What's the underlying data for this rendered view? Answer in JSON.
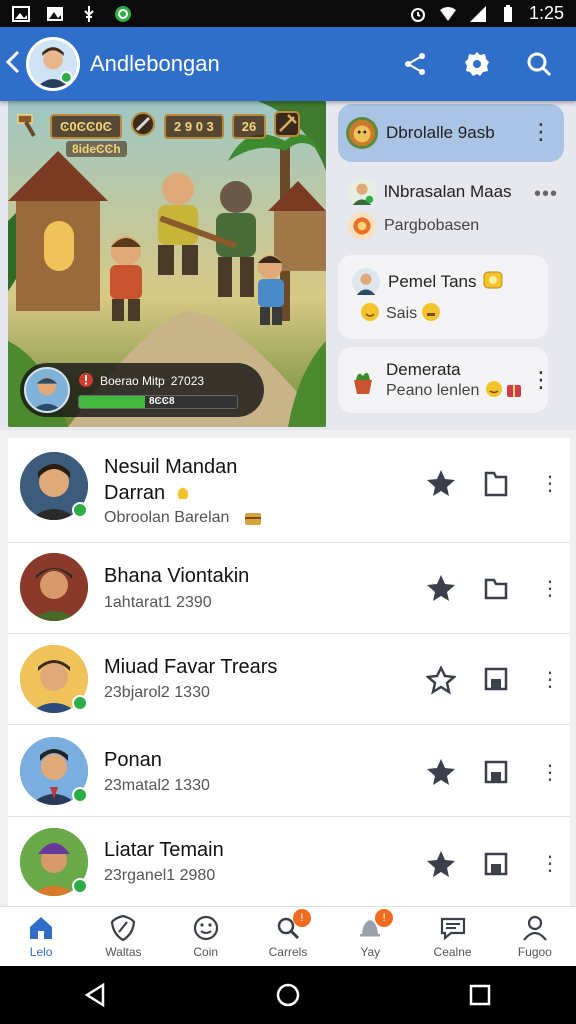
{
  "status_bar": {
    "time": "1:25"
  },
  "header": {
    "title": "Andlebongan"
  },
  "game": {
    "hud_coins": "Ͼ0ϾϾ0Ͼ",
    "hud_sub": "8ideϾϾh",
    "hud_score": "2 9 0 3",
    "hud_level": "26",
    "player_line": "Boerao Mitp",
    "player_value": "27023",
    "bar_text": "8ϾϾ8",
    "health_fraction": 0.42
  },
  "chat": [
    {
      "name": "Dbrolalle 9asb",
      "sub": "",
      "highlight": true
    },
    {
      "name": "lNbrasalan Maas",
      "sub": "Pargbobasen",
      "highlight": false
    },
    {
      "name": "Pemel Tans",
      "sub": "Sais",
      "highlight": false
    },
    {
      "name": "Demerata",
      "sub": "Peano lenlen",
      "highlight": false
    }
  ],
  "contacts": [
    {
      "name": "Nesuil Mandan",
      "name2": "Darran",
      "sub": "Obroolan Barelan",
      "color": "#3d5b7a"
    },
    {
      "name": "Bhana Viontakin",
      "sub": "1ahtarat1 2390",
      "color": "#8a5a2a"
    },
    {
      "name": "Miuad Favar Trears",
      "sub": "23bjarol2 1330",
      "color": "#c4873f"
    },
    {
      "name": "Ponan",
      "sub": "23matal2 1330",
      "color": "#4a78b8"
    },
    {
      "name": "Liatar Temain",
      "sub": "23rganel1 2980",
      "color": "#5b9b3d"
    }
  ],
  "nav": [
    {
      "label": "Lelo",
      "icon": "home-icon",
      "badge": ""
    },
    {
      "label": "Waltas",
      "icon": "shield-icon",
      "badge": ""
    },
    {
      "label": "Coin",
      "icon": "smiley-icon",
      "badge": ""
    },
    {
      "label": "Carrels",
      "icon": "search-icon",
      "badge": "!"
    },
    {
      "label": "Yay",
      "icon": "bell-icon",
      "badge": "!"
    },
    {
      "label": "Cealne",
      "icon": "chat-icon",
      "badge": ""
    },
    {
      "label": "Fugoo",
      "icon": "profile-icon",
      "badge": ""
    }
  ],
  "colors": {
    "primary": "#2f6fc9",
    "online": "#2dad45",
    "badge": "#f06b1f"
  }
}
